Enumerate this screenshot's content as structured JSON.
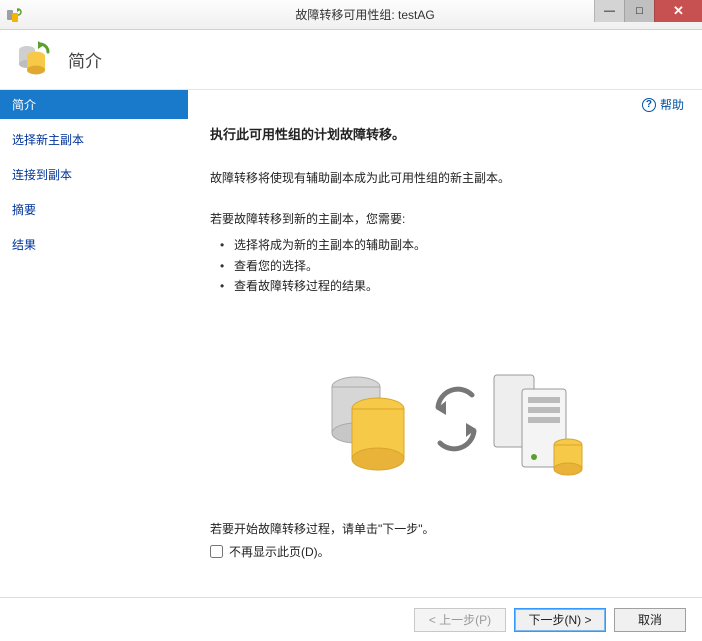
{
  "titlebar": {
    "title": "故障转移可用性组: testAG"
  },
  "header": {
    "title": "简介"
  },
  "sidebar": {
    "items": [
      {
        "label": "简介",
        "active": true
      },
      {
        "label": "选择新主副本",
        "active": false
      },
      {
        "label": "连接到副本",
        "active": false
      },
      {
        "label": "摘要",
        "active": false
      },
      {
        "label": "结果",
        "active": false
      }
    ]
  },
  "content": {
    "help_label": "帮助",
    "subject": "执行此可用性组的计划故障转移。",
    "desc": "故障转移将使现有辅助副本成为此可用性组的新主副本。",
    "need_intro": "若要故障转移到新的主副本，您需要:",
    "bullets": [
      "选择将成为新的主副本的辅助副本。",
      "查看您的选择。",
      "查看故障转移过程的结果。"
    ],
    "start_hint": "若要开始故障转移过程，请单击\"下一步\"。",
    "dont_show": "不再显示此页(D)。"
  },
  "footer": {
    "prev": "<  上一步(P)",
    "next": "下一步(N)  >",
    "cancel": "取消"
  }
}
